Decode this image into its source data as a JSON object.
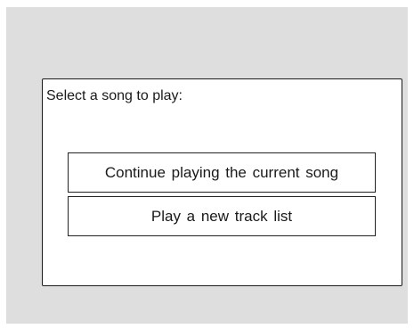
{
  "dialog": {
    "prompt": "Select a song to play:",
    "options": [
      {
        "label": "Continue playing the  current song"
      },
      {
        "label": "Play a  new  track  list"
      }
    ]
  },
  "colors": {
    "screen_background": "#dededf",
    "dialog_background": "#ffffff",
    "border": "#1a1a1a",
    "text": "#1a1a1a"
  }
}
